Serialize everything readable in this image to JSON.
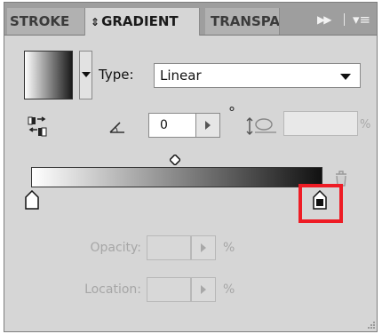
{
  "tabs": [
    {
      "label": "STROKE",
      "active": false
    },
    {
      "label": "GRADIENT",
      "active": true,
      "prefix_icon": "updown-arrows-icon"
    },
    {
      "label": "TRANSPARENCY",
      "active": false
    }
  ],
  "panel_controls": {
    "more_icon": "double-chevron-right-icon",
    "menu_icon": "panel-menu-icon"
  },
  "gradient": {
    "type_label": "Type:",
    "type_value": "Linear",
    "angle_value": "0",
    "degree_symbol": "°",
    "aspect_value": "",
    "aspect_unit": "%",
    "start_color": "#ffffff",
    "end_color": "#111111"
  },
  "stop_controls": {
    "opacity_label": "Opacity:",
    "opacity_value": "",
    "opacity_unit": "%",
    "location_label": "Location:",
    "location_value": "",
    "location_unit": "%"
  },
  "highlight_color": "#ee1c25"
}
